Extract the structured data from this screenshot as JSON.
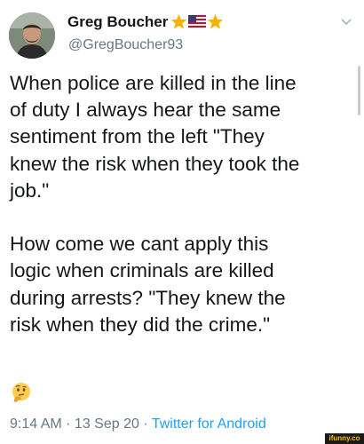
{
  "tweet": {
    "author": {
      "display_name": "Greg Boucher",
      "handle": "@GregBoucher93",
      "badge_icons": [
        "star-icon",
        "us-flag-icon",
        "star-icon"
      ]
    },
    "text_paragraphs": [
      [
        "When police are killed in the line",
        "of duty I always hear the same",
        "sentiment from the left \"They",
        "knew the risk when they took the",
        "job.\""
      ],
      [
        "How come we cant apply this",
        "logic when criminals are killed",
        "during arrests? \"They knew the",
        "risk when they did the crime.\""
      ]
    ],
    "emoji": "thinking-face-icon",
    "timestamp": "9:14 AM · 13 Sep 20 · ",
    "source": "Twitter for Android"
  },
  "watermark": "ifunny.co",
  "colors": {
    "text": "#14171a",
    "secondary_text": "#657786",
    "link": "#1da1f2",
    "star": "#f5b300"
  }
}
